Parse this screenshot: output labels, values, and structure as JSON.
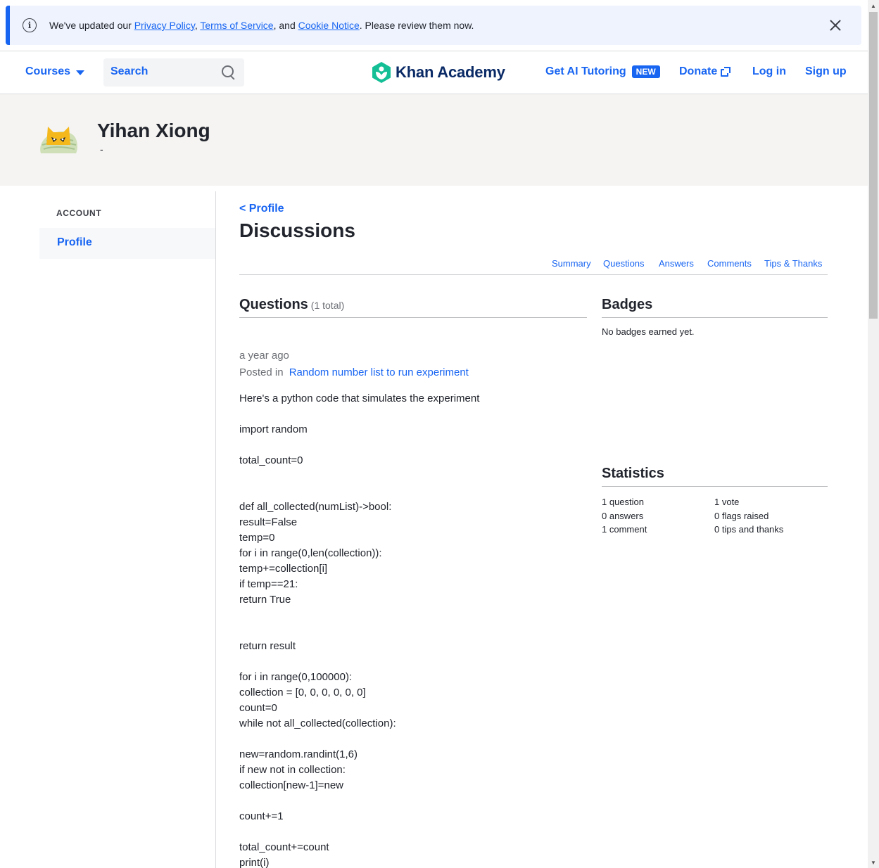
{
  "banner": {
    "prefix": "We've updated our ",
    "privacy_link": "Privacy Policy",
    "sep1": ", ",
    "terms_link": "Terms of Service",
    "sep2": ", and ",
    "cookie_link": "Cookie Notice",
    "suffix": ". Please review them now."
  },
  "header": {
    "courses_label": "Courses",
    "search_placeholder": "Search",
    "logo_text": "Khan Academy",
    "ai_tutoring_label": "Get AI Tutoring",
    "new_badge": "NEW",
    "donate_label": "Donate",
    "login_label": "Log in",
    "signup_label": "Sign up"
  },
  "profile": {
    "name": "Yihan Xiong",
    "subtitle": "-"
  },
  "sidebar": {
    "section_label": "ACCOUNT",
    "items": [
      {
        "label": "Profile",
        "active": true
      }
    ]
  },
  "main": {
    "back_link": "< Profile",
    "title": "Discussions",
    "tabs": [
      {
        "label": "Summary"
      },
      {
        "label": "Questions"
      },
      {
        "label": "Answers"
      },
      {
        "label": "Comments"
      },
      {
        "label": "Tips & Thanks"
      }
    ],
    "questions_heading": "Questions",
    "questions_total": "(1 total)",
    "post": {
      "time_ago": "a year ago",
      "posted_in_label": "Posted in",
      "posted_in_link": "Random number list to run experiment",
      "body_lines": [
        "Here's a python code that simulates the experiment",
        "",
        "import random",
        "",
        "total_count=0",
        "",
        "",
        "def all_collected(numList)->bool:",
        "result=False",
        "temp=0",
        "for i in range(0,len(collection)):",
        "temp+=collection[i]",
        "if temp==21:",
        "return True",
        "",
        "",
        "return result",
        "",
        "for i in range(0,100000):",
        "collection = [0, 0, 0, 0, 0, 0]",
        "count=0",
        "while not all_collected(collection):",
        "",
        "new=random.randint(1,6)",
        "if new not in collection:",
        "collection[new-1]=new",
        "",
        "count+=1",
        "",
        "total_count+=count",
        "print(i)"
      ]
    }
  },
  "badges": {
    "heading": "Badges",
    "empty_text": "No badges earned yet."
  },
  "statistics": {
    "heading": "Statistics",
    "col1": [
      "1 question",
      "0 answers",
      "1 comment"
    ],
    "col2": [
      "1 vote",
      "0 flags raised",
      "0 tips and thanks"
    ]
  },
  "colors": {
    "accent": "#1865f2",
    "logo_green": "#14bf96",
    "text": "#21242c",
    "banner_bg": "#eef3fd",
    "profile_band_bg": "#f5f4f2"
  },
  "icons": {
    "banner": "info-icon",
    "banner_close": "close-icon",
    "search": "search-icon",
    "courses": "chevron-down-icon",
    "donate": "external-link-icon"
  }
}
